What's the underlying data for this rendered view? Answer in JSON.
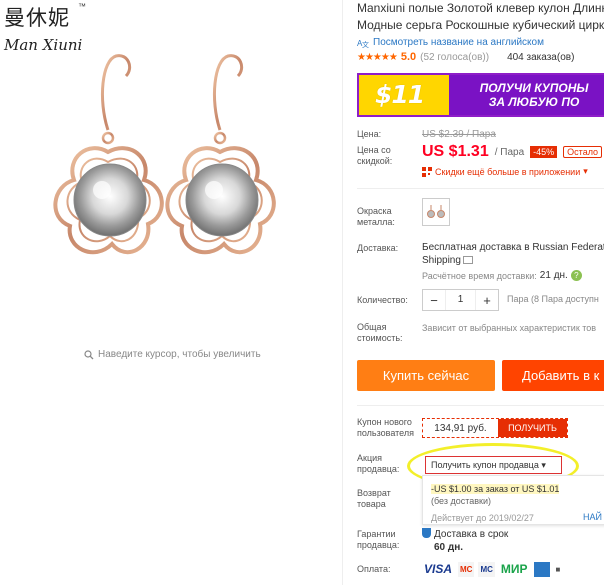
{
  "brand": {
    "cn": "曼休妮",
    "tm": "™",
    "script": "Man Xiuni"
  },
  "image": {
    "zoom_hint": "Наведите курсор, чтобы увеличить"
  },
  "product": {
    "title_line1": "Manxiuni полые Золотой клевер кулон Длинн",
    "title_line2": "Модные серьга Роскошные кубический цирк",
    "translate_link": "Посмотреть название на английском",
    "rating_score": "5.0",
    "rating_votes": "(52 голоса(ов))",
    "orders": "404 заказа(ов)"
  },
  "banner": {
    "big": "$11",
    "line1": "ПОЛУЧИ КУПОНЫ",
    "line2": "ЗА ЛЮБУЮ ПО"
  },
  "price": {
    "label": "Цена:",
    "old": "US $2.39 / Пара",
    "discount_label_1": "Цена со",
    "discount_label_2": "скидкой:",
    "amount": "US $1.31",
    "unit": "/ Пара",
    "discount": "-45%",
    "left_badge": "Остало",
    "app_discount": "Скидки ещё больше в приложении"
  },
  "color": {
    "label_1": "Окраска",
    "label_2": "металла:"
  },
  "delivery": {
    "label": "Доставка:",
    "line1": "Бесплатная доставка в Russian Federat",
    "line2": "Shipping",
    "estimate_label": "Расчётное время доставки:",
    "estimate_value": "21 дн."
  },
  "quantity": {
    "label": "Количество:",
    "minus": "−",
    "value": "1",
    "plus": "+",
    "note": "Пара (8 Пара доступн"
  },
  "total": {
    "label_1": "Общая",
    "label_2": "стоимость:",
    "value": "Зависит от выбранных характеристик тов"
  },
  "actions": {
    "buy": "Купить сейчас",
    "cart": "Добавить в к"
  },
  "new_user_coupon": {
    "label_1": "Купон нового",
    "label_2": "пользователя",
    "value": "134,91 руб.",
    "button": "ПОЛУЧИТЬ"
  },
  "seller_promo": {
    "label_1": "Акция",
    "label_2": "продавца:",
    "select": "Получить купон продавца",
    "offer": "-US $1.00 за заказ от US $1.01",
    "sub": "(без доставки)",
    "valid": "Действует до 2019/02/27",
    "find": "НАЙ"
  },
  "returns": {
    "label_1": "Возврат",
    "label_2": "товара"
  },
  "guarantee": {
    "label_1": "Гарантии",
    "label_2": "продавца:",
    "value": "Доставка в срок",
    "days": "60 дн."
  },
  "payment": {
    "label": "Оплата:",
    "methods": [
      "VISA",
      "MC",
      "MC",
      "МИР",
      "",
      "■"
    ]
  },
  "colors": {
    "accent": "#e62e04",
    "buy": "#ff7e14",
    "cart": "#ff4400",
    "link": "#2b78c4",
    "banner_purple": "#7a12c4",
    "banner_yellow": "#ffd600",
    "highlight": "#f3ef2a"
  }
}
